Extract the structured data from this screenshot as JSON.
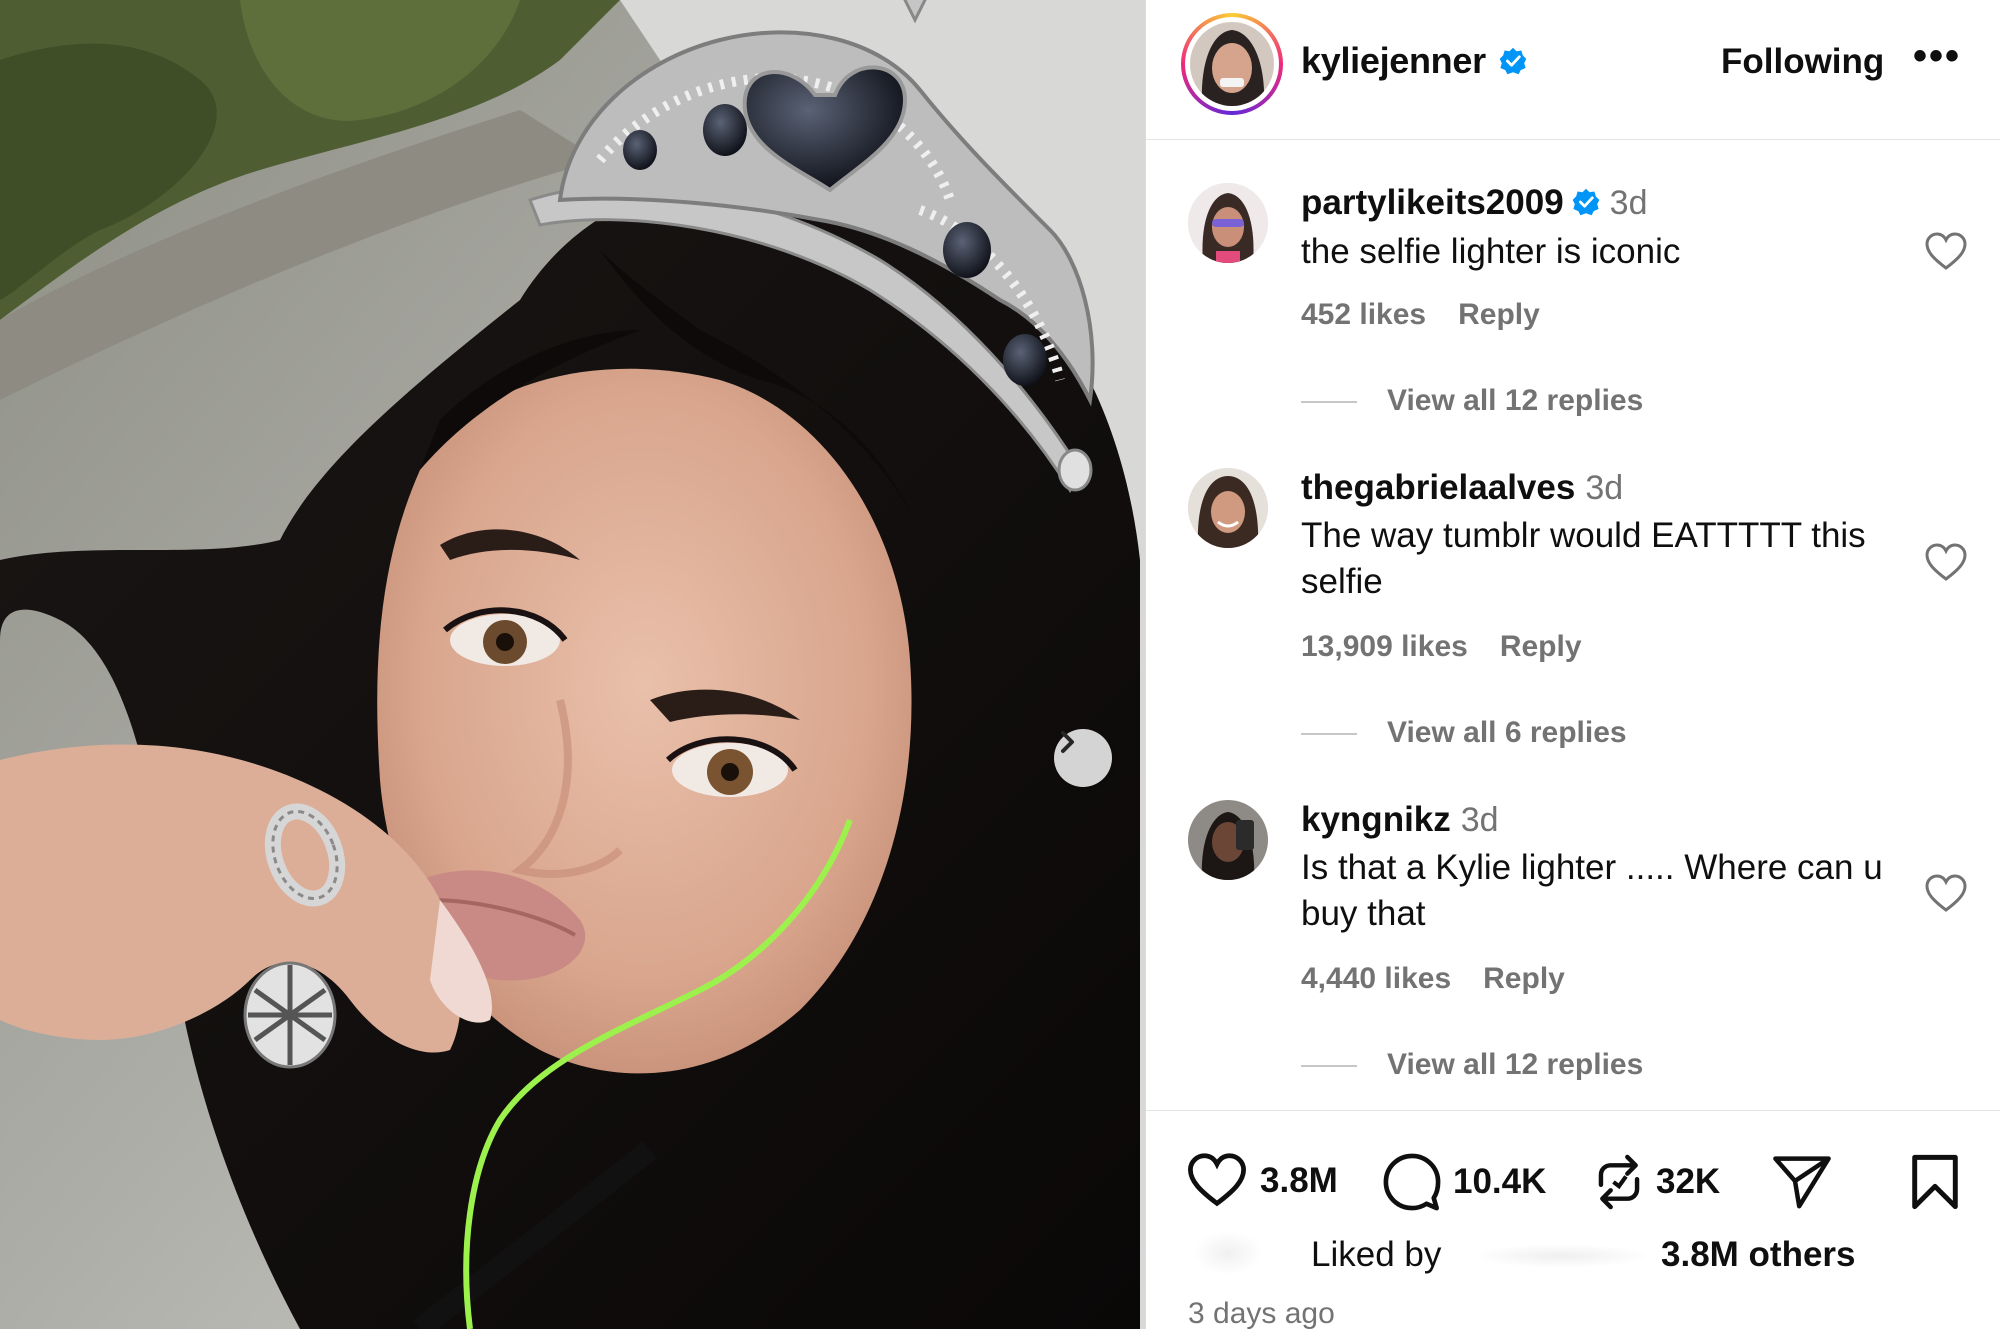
{
  "post": {
    "owner": {
      "username": "kyliejenner",
      "verified": true
    },
    "follow_label": "Following",
    "more_label": "•••",
    "timestamp": "3 days ago"
  },
  "comments": [
    {
      "username": "partylikeits2009",
      "verified": true,
      "time": "3d",
      "text": "the selfie lighter is iconic",
      "likes": "452 likes",
      "reply_label": "Reply",
      "view_replies": "View all 12 replies"
    },
    {
      "username": "thegabrielaalves",
      "verified": false,
      "time": "3d",
      "text": "The way tumblr would EATTTTT this selfie",
      "likes": "13,909 likes",
      "reply_label": "Reply",
      "view_replies": "View all 6 replies"
    },
    {
      "username": "kyngnikz",
      "verified": false,
      "time": "3d",
      "text": "Is that a Kylie lighter ..... Where can u buy that",
      "likes": "4,440 likes",
      "reply_label": "Reply",
      "view_replies": "View all 12 replies"
    }
  ],
  "actions": {
    "likes": "3.8M",
    "comments": "10.4K",
    "reposts": "32K",
    "liked_by_label": "Liked by",
    "liked_by_others": "3.8M others"
  },
  "colors": {
    "verified": "#0095f6",
    "muted": "#737373",
    "text": "#0f0f0f"
  },
  "icons": [
    "chevron-right-icon",
    "verified-badge-icon",
    "heart-icon",
    "comment-icon",
    "repost-icon",
    "share-icon",
    "bookmark-icon"
  ]
}
